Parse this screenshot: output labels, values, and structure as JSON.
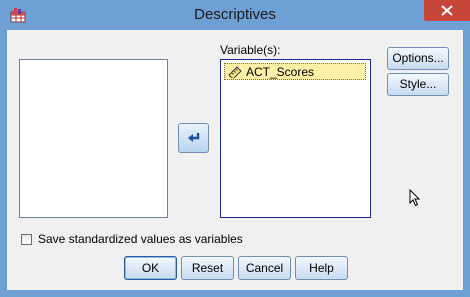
{
  "window": {
    "title": "Descriptives"
  },
  "variables": {
    "label": "Variable(s):",
    "items": [
      "ACT_Scores"
    ]
  },
  "buttons": {
    "options": "Options...",
    "style": "Style...",
    "ok": "OK",
    "reset": "Reset",
    "cancel": "Cancel",
    "help": "Help"
  },
  "checkbox": {
    "label": "Save standardized values as variables",
    "checked": false
  },
  "icons": {
    "app": "spss-table-icon",
    "close": "close-icon",
    "move": "move-arrow-icon",
    "scale": "ruler-icon"
  }
}
